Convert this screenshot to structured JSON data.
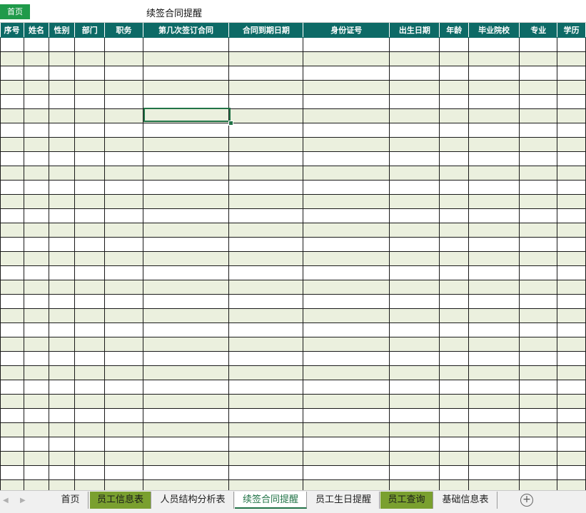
{
  "topbar": {
    "home_button": "首页",
    "title": "续签合同提醒"
  },
  "table": {
    "headers": [
      "序号",
      "姓名",
      "性别",
      "部门",
      "职务",
      "第几次签订合同",
      "合同到期日期",
      "身份证号",
      "出生日期",
      "年龄",
      "毕业院校",
      "专业",
      "学历"
    ],
    "row_count": 32,
    "row_colors": [
      "#ffffff",
      "#ebf0de"
    ],
    "header_color": "#0d6a66"
  },
  "sheet_tabs": {
    "tabs": [
      {
        "label": "首页",
        "style": "normal"
      },
      {
        "label": "员工信息表",
        "style": "green"
      },
      {
        "label": "人员结构分析表",
        "style": "normal"
      },
      {
        "label": "续签合同提醒",
        "style": "active"
      },
      {
        "label": "员工生日提醒",
        "style": "normal"
      },
      {
        "label": "员工查询",
        "style": "green"
      },
      {
        "label": "基础信息表",
        "style": "normal"
      }
    ],
    "add_icon": "plus-circle-icon",
    "prev_icon": "arrow-left-icon",
    "next_icon": "arrow-right-icon"
  }
}
